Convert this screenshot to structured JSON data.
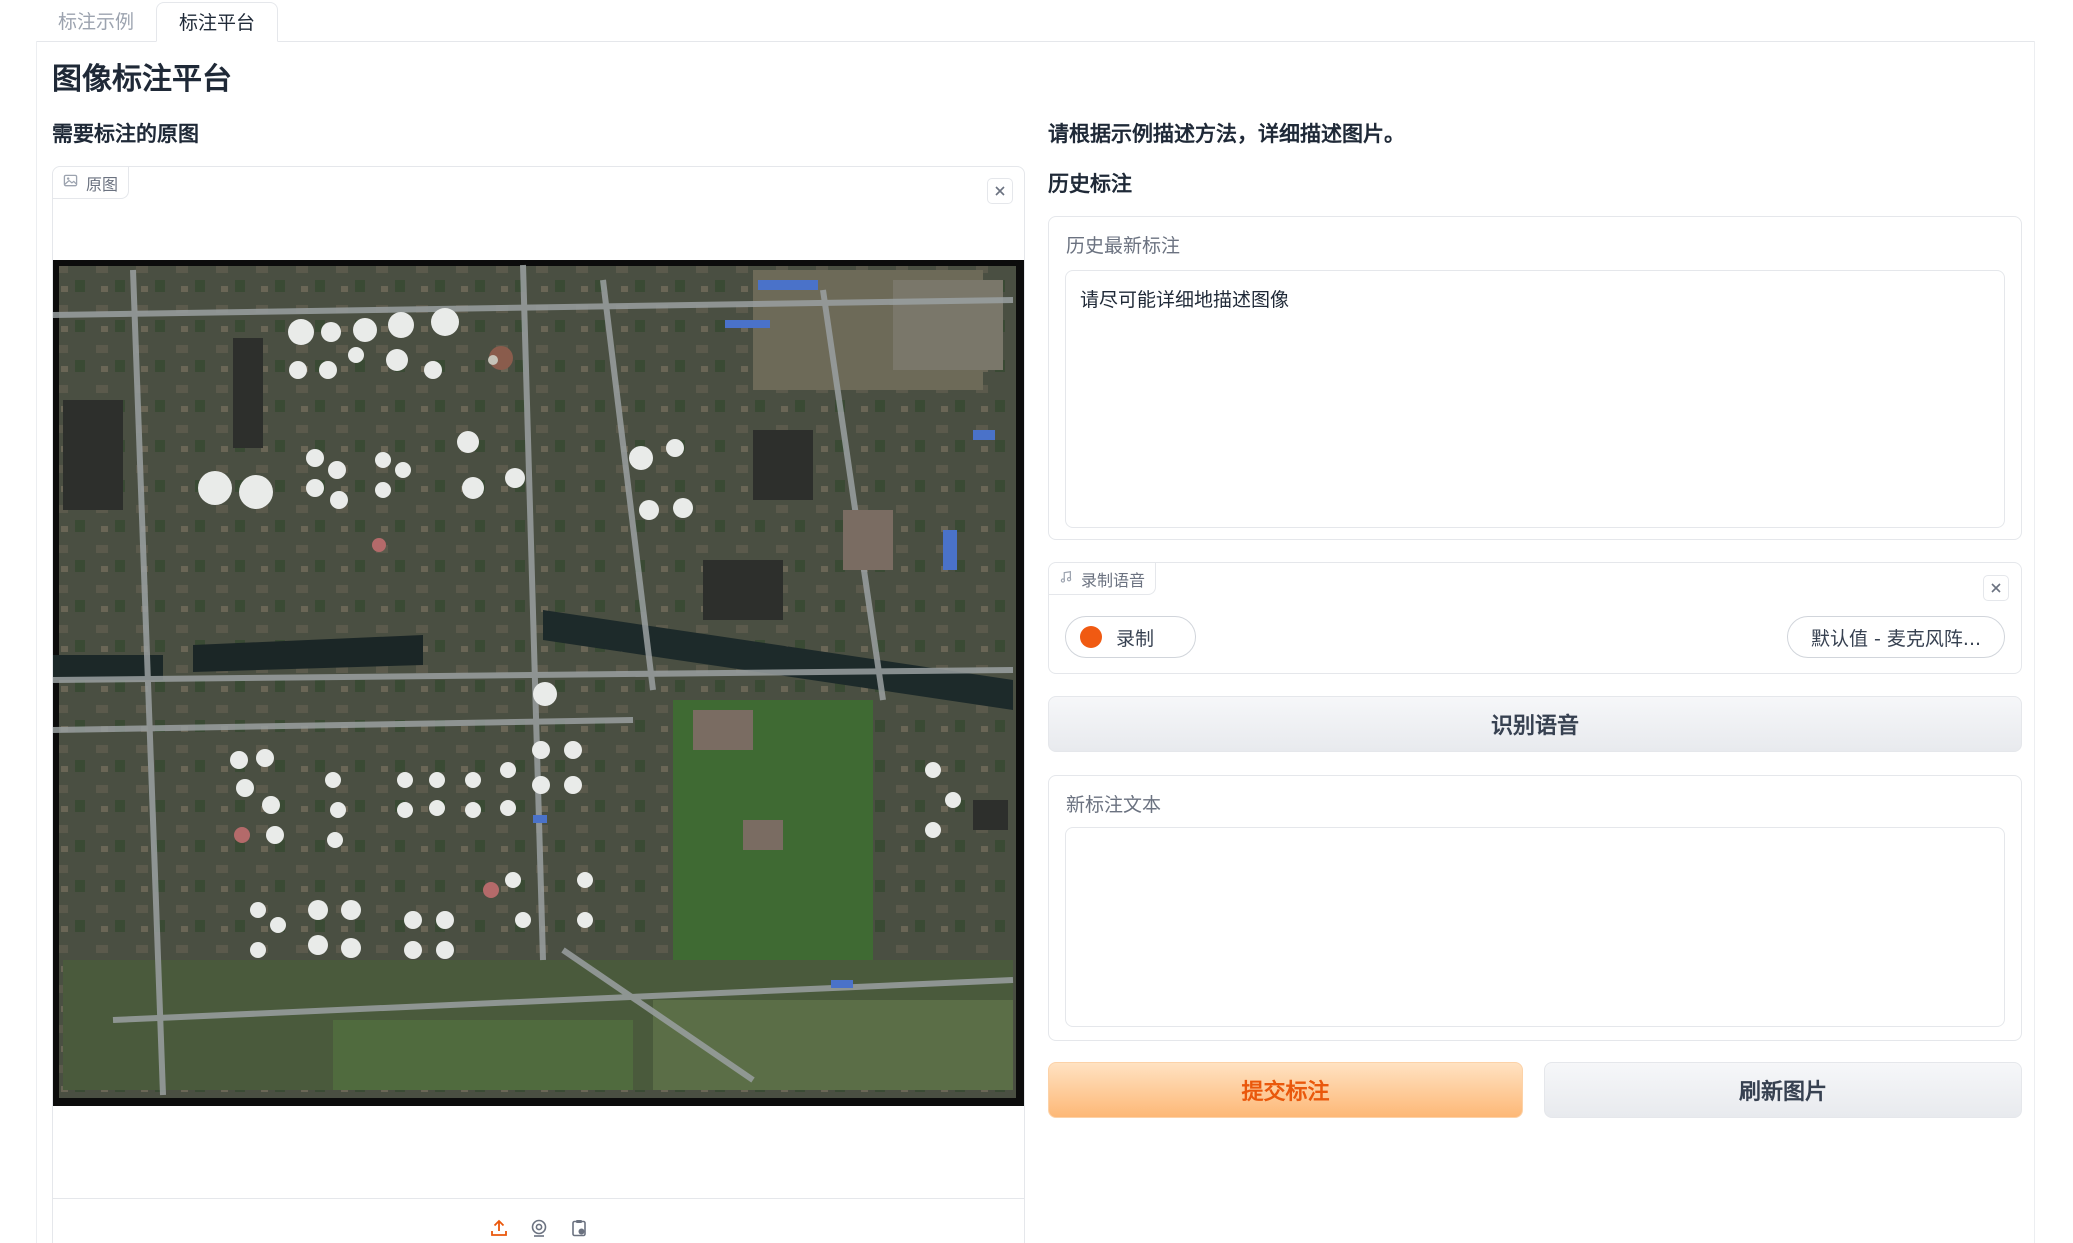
{
  "tabs": [
    {
      "label": "标注示例",
      "active": false
    },
    {
      "label": "标注平台",
      "active": true
    }
  ],
  "page_title": "图像标注平台",
  "left": {
    "section_title": "需要标注的原图",
    "image_tag": "原图",
    "upload_icons": [
      "upload-icon",
      "webcam-icon",
      "clipboard-icon"
    ]
  },
  "right": {
    "instruction": "请根据示例描述方法，详细描述图片。",
    "history_title": "历史标注",
    "history_card": {
      "label": "历史最新标注",
      "value": "请尽可能详细地描述图像"
    },
    "audio": {
      "tag": "录制语音",
      "record_label": "录制",
      "device_label": "默认值 - 麦克风阵..."
    },
    "recognize_button": "识别语音",
    "new_card": {
      "label": "新标注文本",
      "value": ""
    },
    "submit_button": "提交标注",
    "refresh_button": "刷新图片"
  },
  "colors": {
    "accent": "#ea580c",
    "record_dot": "#f05a12",
    "primary_button_bg": "#fdb877"
  }
}
